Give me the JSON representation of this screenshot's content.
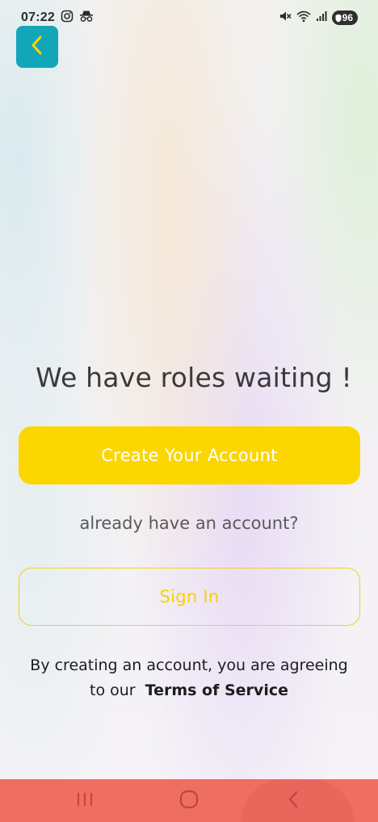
{
  "status_bar": {
    "time": "07:22",
    "battery": "96",
    "icons": [
      "instagram-icon",
      "incognito-icon",
      "mute-icon",
      "wifi-icon",
      "signal-icon",
      "battery-icon"
    ]
  },
  "header": {
    "back_icon": "chevron-left-icon",
    "accent_color": "#11a7b9"
  },
  "main": {
    "headline": "We have roles waiting !",
    "create_button_label": "Create Your Account",
    "already_text": "already have an account?",
    "signin_button_label": "Sign In",
    "terms_prefix": "By creating an account, you are agreeing",
    "terms_to_our": "to our",
    "terms_link": "Terms of Service",
    "brand_color": "#fbd600"
  },
  "nav_bar": {
    "color": "#ef6d61",
    "items": [
      "recent-apps-icon",
      "home-icon",
      "back-icon"
    ]
  }
}
